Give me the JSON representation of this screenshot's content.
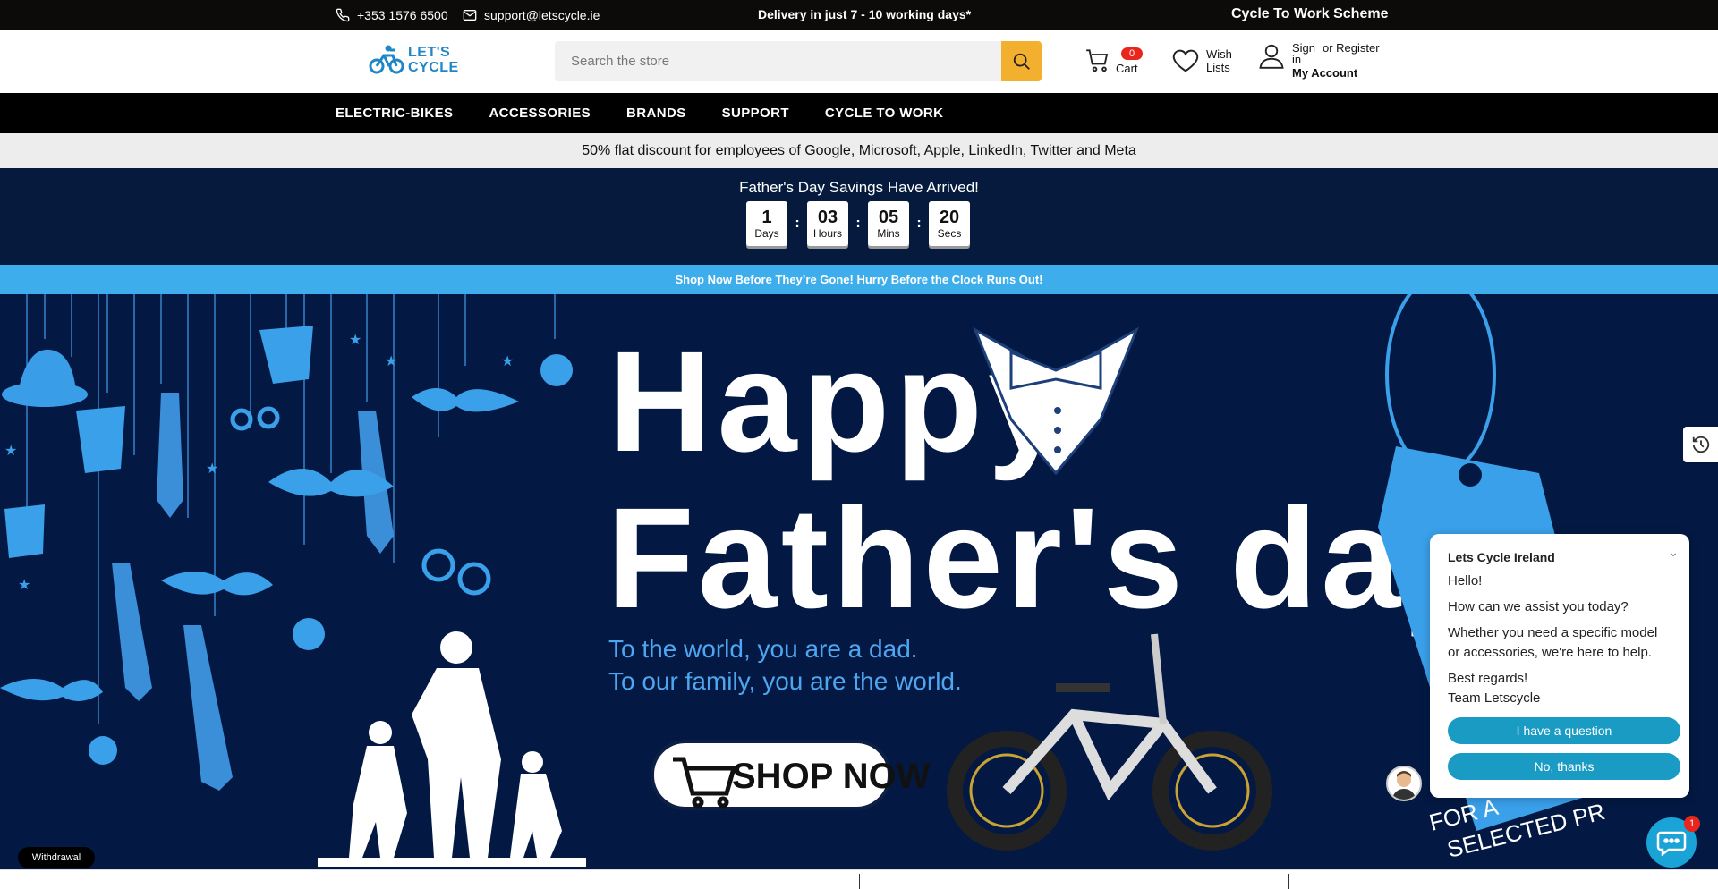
{
  "topbar": {
    "phone": "+353 1576 6500",
    "email": "support@letscycle.ie",
    "delivery": "Delivery in just 7 - 10 working days*",
    "cycle_to_work": "Cycle To Work Scheme"
  },
  "header": {
    "logo_line1": "LET'S",
    "logo_line2": "CYCLE",
    "search_placeholder": "Search the store",
    "cart_count": "0",
    "cart_label": "Cart",
    "wish_line1": "Wish",
    "wish_line2": "Lists",
    "sign_in": "Sign in",
    "or_register": "or Register",
    "my_account": "My Account"
  },
  "nav": {
    "items": [
      "ELECTRIC-BIKES",
      "ACCESSORIES",
      "BRANDS",
      "SUPPORT",
      "CYCLE TO WORK"
    ]
  },
  "promo": "50% flat discount for employees of Google, Microsoft, Apple, LinkedIn, Twitter and Meta",
  "countdown": {
    "title": "Father's Day Savings Have Arrived!",
    "days": "1",
    "days_label": "Days",
    "hours": "03",
    "hours_label": "Hours",
    "mins": "05",
    "mins_label": "Mins",
    "secs": "20",
    "secs_label": "Secs"
  },
  "shopbar": "Shop Now Before They’re Gone! Hurry Before the Clock Runs Out!",
  "hero": {
    "line1": "Happy",
    "line2": "Father's day",
    "sub1": "To the world, you are a dad.",
    "sub2": "To our family, you are the world.",
    "shop_now": "SHOP NOW",
    "tag_text1": "FOR A",
    "tag_text2": "SELECTED PR"
  },
  "withdrawal": "Withdrawal",
  "chat": {
    "title": "Lets Cycle Ireland",
    "hello": "Hello!",
    "q": "How can we assist you today?",
    "body": "Whether you need a specific model or accessories, we're here to help.",
    "regards": "Best regards!",
    "team": "Team Letscycle",
    "btn1": "I have a question",
    "btn2": "No, thanks",
    "unread": "1"
  },
  "colors": {
    "accent": "#f3b02e",
    "hero_bg": "#031943",
    "light_blue": "#3eadeb",
    "chat_btn": "#1a9bc4"
  }
}
